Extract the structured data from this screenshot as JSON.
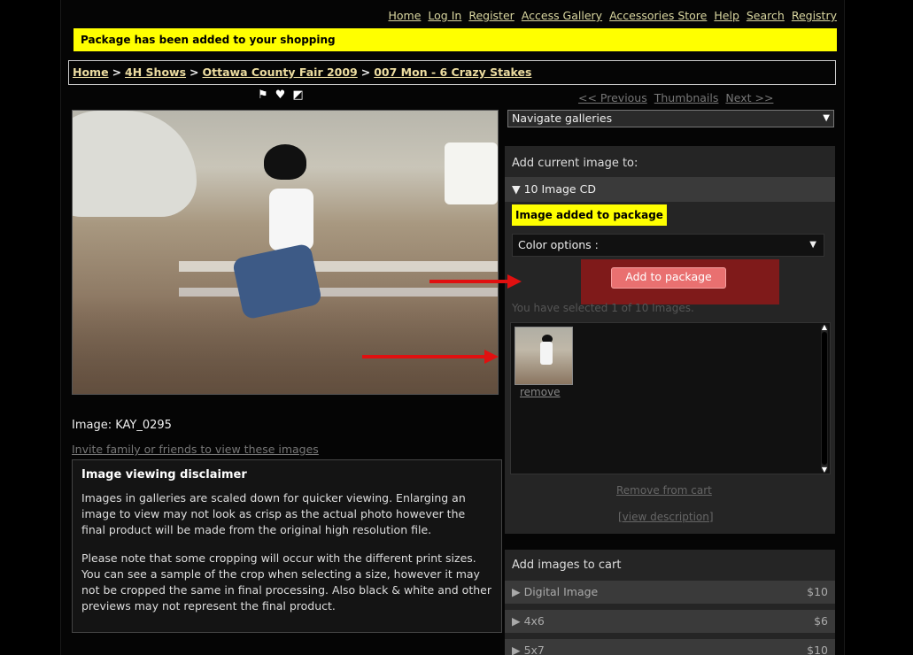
{
  "topnav": [
    "Home",
    "Log In",
    "Register",
    "Access Gallery",
    "Accessories Store",
    "Help",
    "Search",
    "Registry"
  ],
  "notice": "Package has been added to your shopping",
  "breadcrumb": {
    "items": [
      "Home",
      "4H Shows",
      "Ottawa County Fair 2009",
      "007 Mon - 6 Crazy Stakes"
    ],
    "separator": ">"
  },
  "tools": {
    "flag": "⚑",
    "heart": "♥",
    "contrast": "◩"
  },
  "pager": {
    "previous": "<< Previous",
    "thumbnails": "Thumbnails",
    "next": "Next >>"
  },
  "nav_select": {
    "value": "Navigate galleries"
  },
  "image": {
    "label": "Image: KAY_0295",
    "invite": "Invite family or friends to view these images"
  },
  "disclaimer": {
    "title": "Image viewing disclaimer",
    "p1": "Images in galleries are scaled down for quicker viewing. Enlarging an image to view may not look as crisp as the actual photo however the final product will be made from the original high resolution file.",
    "p2": "Please note that some cropping will occur with the different print sizes. You can see a sample of the crop when selecting a size, however it may not be cropped the same in final processing. Also black & white and other previews may not represent the final product."
  },
  "package_panel": {
    "title": "Add current image to:",
    "section": "▼ 10 Image CD",
    "added": "Image added to package",
    "color_select": "Color options :",
    "add_button": "Add to package",
    "selected_info": "You have selected 1 of 10 Images.",
    "thumb_remove": "remove",
    "remove_from_cart": "Remove from cart",
    "view_description": "[view description]"
  },
  "cart_panel": {
    "title": "Add images to cart",
    "rows": [
      {
        "label": "▶ Digital Image",
        "price": "$10"
      },
      {
        "label": "▶ 4x6",
        "price": "$6"
      },
      {
        "label": "▶ 5x7",
        "price": "$10"
      }
    ]
  },
  "colors": {
    "highlight": "#ffff00",
    "accent_red": "#e01010",
    "link": "#d9d6a0"
  }
}
